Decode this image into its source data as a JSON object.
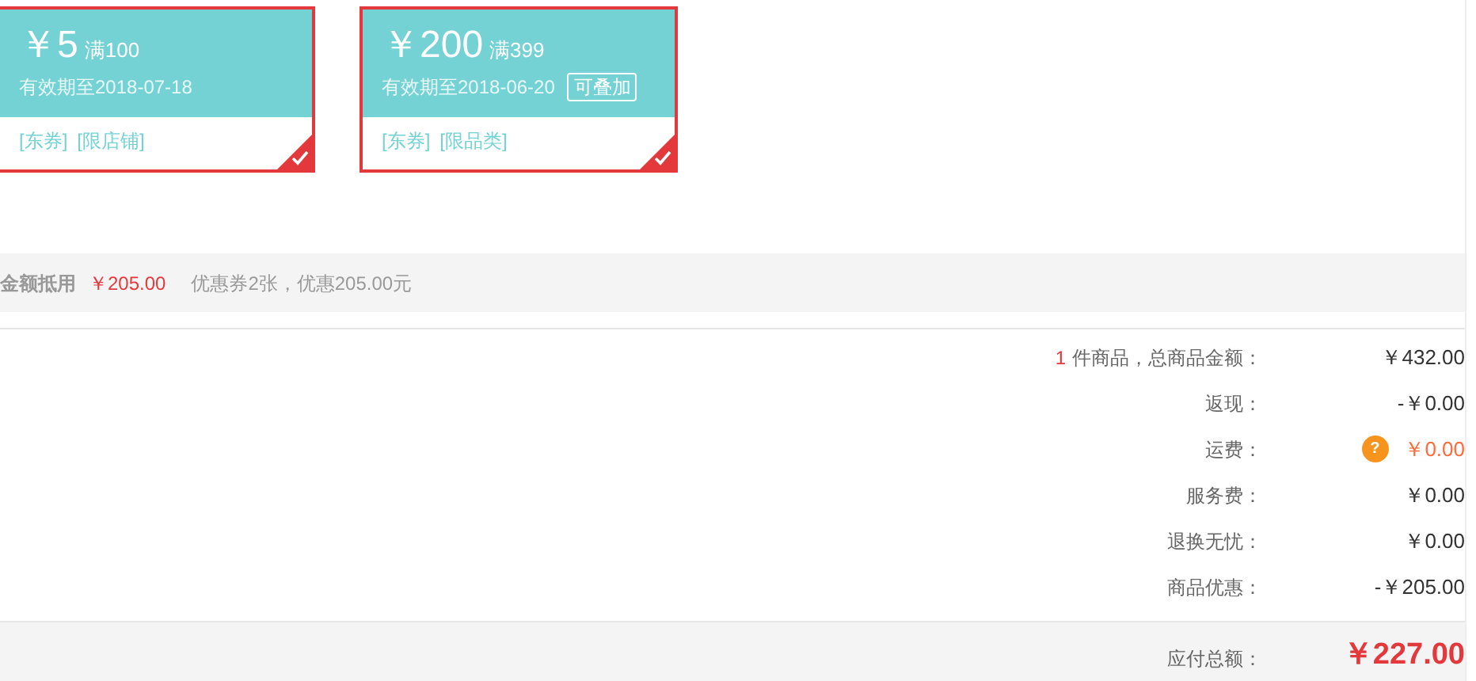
{
  "coupons": [
    {
      "currency": "￥",
      "amount": "5",
      "condition": "满100",
      "validity": "有效期至2018-07-18",
      "tags": [
        "[东券]",
        "[限店铺]"
      ],
      "selected": true
    },
    {
      "currency": "￥",
      "amount": "200",
      "condition": "满399",
      "validity": "有效期至2018-06-20",
      "badge": "可叠加",
      "tags": [
        "[东券]",
        "[限品类]"
      ],
      "selected": true
    }
  ],
  "discount_bar": {
    "label": "金额抵用",
    "amount": "￥205.00",
    "note": "优惠券2张，优惠205.00元"
  },
  "summary": [
    {
      "kind": "count",
      "count": "1",
      "label": "件商品，总商品金额：",
      "value": "￥432.00"
    },
    {
      "kind": "plain",
      "label": "返现：",
      "value": "-￥0.00"
    },
    {
      "kind": "freight",
      "label": "运费：",
      "icon_text": "?",
      "value": "￥0.00"
    },
    {
      "kind": "plain",
      "label": "服务费：",
      "value": "￥0.00"
    },
    {
      "kind": "plain",
      "label": "退换无忧：",
      "value": "￥0.00"
    },
    {
      "kind": "plain",
      "label": "商品优惠：",
      "value": "-￥205.00"
    }
  ],
  "total": {
    "label": "应付总额：",
    "value": "￥227.00"
  }
}
